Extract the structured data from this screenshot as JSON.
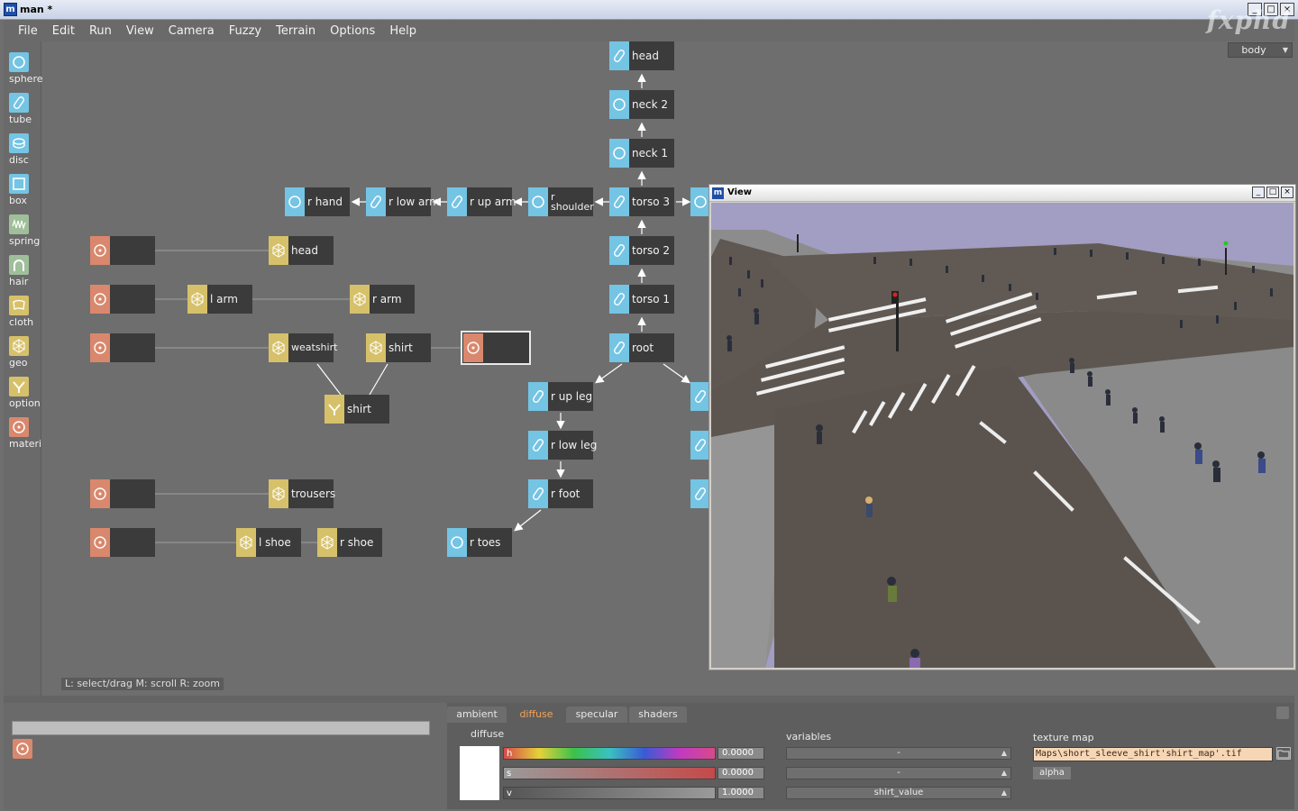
{
  "window": {
    "title": "man *",
    "app_icon": "m",
    "controls": [
      "_",
      "□",
      "×"
    ]
  },
  "menu": [
    "File",
    "Edit",
    "Run",
    "View",
    "Camera",
    "Fuzzy",
    "Terrain",
    "Options",
    "Help"
  ],
  "logo": "fxphd",
  "context_select": {
    "value": "body"
  },
  "palette": [
    {
      "label": "sphere",
      "icon": "sphere-icon",
      "color": "#74c4e4"
    },
    {
      "label": "tube",
      "icon": "tube-icon",
      "color": "#74c4e4"
    },
    {
      "label": "disc",
      "icon": "disc-icon",
      "color": "#74c4e4"
    },
    {
      "label": "box",
      "icon": "box-icon",
      "color": "#74c4e4"
    },
    {
      "label": "spring",
      "icon": "spring-icon",
      "color": "#9fbf9a"
    },
    {
      "label": "hair",
      "icon": "hair-icon",
      "color": "#9fbf9a"
    },
    {
      "label": "cloth",
      "icon": "cloth-icon",
      "color": "#d6c16a"
    },
    {
      "label": "geo",
      "icon": "geo-icon",
      "color": "#d6c16a"
    },
    {
      "label": "option",
      "icon": "option-icon",
      "color": "#d6c16a"
    },
    {
      "label": "materi",
      "icon": "material-icon",
      "color": "#d9886d"
    }
  ],
  "nodes": {
    "head_seg": "head",
    "neck2": "neck 2",
    "neck1": "neck 1",
    "torso3": "torso 3",
    "torso2": "torso 2",
    "torso1": "torso 1",
    "root": "root",
    "r_hand": "r hand",
    "r_low_arm": "r low arm",
    "r_up_arm": "r up arm",
    "r_shoulder": "r\nshoulder",
    "r_up_leg": "r up leg",
    "r_low_leg": "r low leg",
    "r_foot": "r foot",
    "r_toes": "r toes",
    "geo_head": "head",
    "l_arm": "l arm",
    "r_arm": "r arm",
    "weatshirt": "weatshirt",
    "shirt_geo": "shirt",
    "shirt_option": "shirt",
    "trousers": "trousers",
    "l_shoe": "l shoe",
    "r_shoe": "r shoe"
  },
  "hint": "L: select/drag   M: scroll   R: zoom",
  "view_window": {
    "title": "View",
    "app_icon": "m",
    "controls": [
      "_",
      "□",
      "×"
    ]
  },
  "material_editor": {
    "tabs": [
      "ambient",
      "diffuse",
      "specular",
      "shaders"
    ],
    "active_tab": "diffuse",
    "section_label": "diffuse",
    "swatch_color": "#ffffff",
    "channels": [
      {
        "label": "h",
        "value": "0.0000"
      },
      {
        "label": "s",
        "value": "0.0000"
      },
      {
        "label": "v",
        "value": "1.0000"
      }
    ],
    "variables_label": "variables",
    "variables": [
      "-",
      "-",
      "shirt_value"
    ],
    "texture_label": "texture map",
    "texture_path": "Maps\\short_sleeve_shirt'shirt_map'.tif",
    "alpha_label": "alpha"
  }
}
